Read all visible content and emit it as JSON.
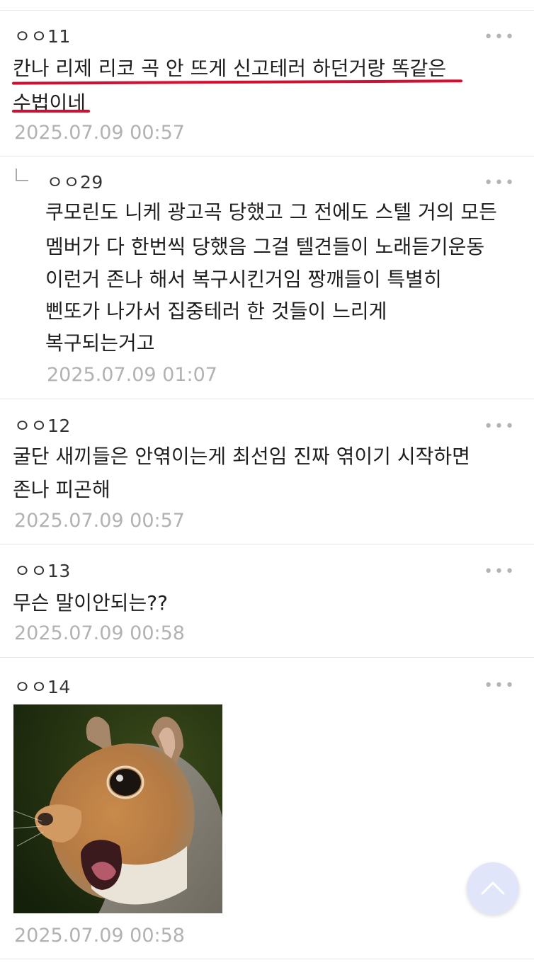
{
  "comments": [
    {
      "nick": "ㅇㅇ11",
      "lines": [
        "칸나 리제 리코 곡 안 뜨게 신고테러 하던거랑 똑같은",
        "수법이네"
      ],
      "date": "2025.07.09 00:57",
      "highlight_color": "#d01030"
    },
    {
      "nick": "ㅇㅇ29",
      "is_reply": true,
      "lines": [
        "쿠모린도 니케 광고곡 당했고 그 전에도 스텔 거의 모든",
        "멤버가 다 한번씩 당했음 그걸 텔견들이 노래듣기운동",
        "이런거 존나 해서 복구시킨거임 짱깨들이 특별히",
        "삔또가 나가서 집중테러 한 것들이 느리게",
        "복구되는거고"
      ],
      "date": "2025.07.09 01:07"
    },
    {
      "nick": "ㅇㅇ12",
      "lines": [
        "굴단 새끼들은 안엮이는게 최선임 진짜 엮이기 시작하면",
        "존나 피곤해"
      ],
      "date": "2025.07.09 00:57"
    },
    {
      "nick": "ㅇㅇ13",
      "lines": [
        "무슨 말이안되는??"
      ],
      "date": "2025.07.09 00:58"
    },
    {
      "nick": "ㅇㅇ14",
      "image": "squirrel-photo",
      "date": "2025.07.09 00:58"
    }
  ],
  "more_icon": "more-dots-icon",
  "scroll_top_icon": "chevron-up-icon"
}
